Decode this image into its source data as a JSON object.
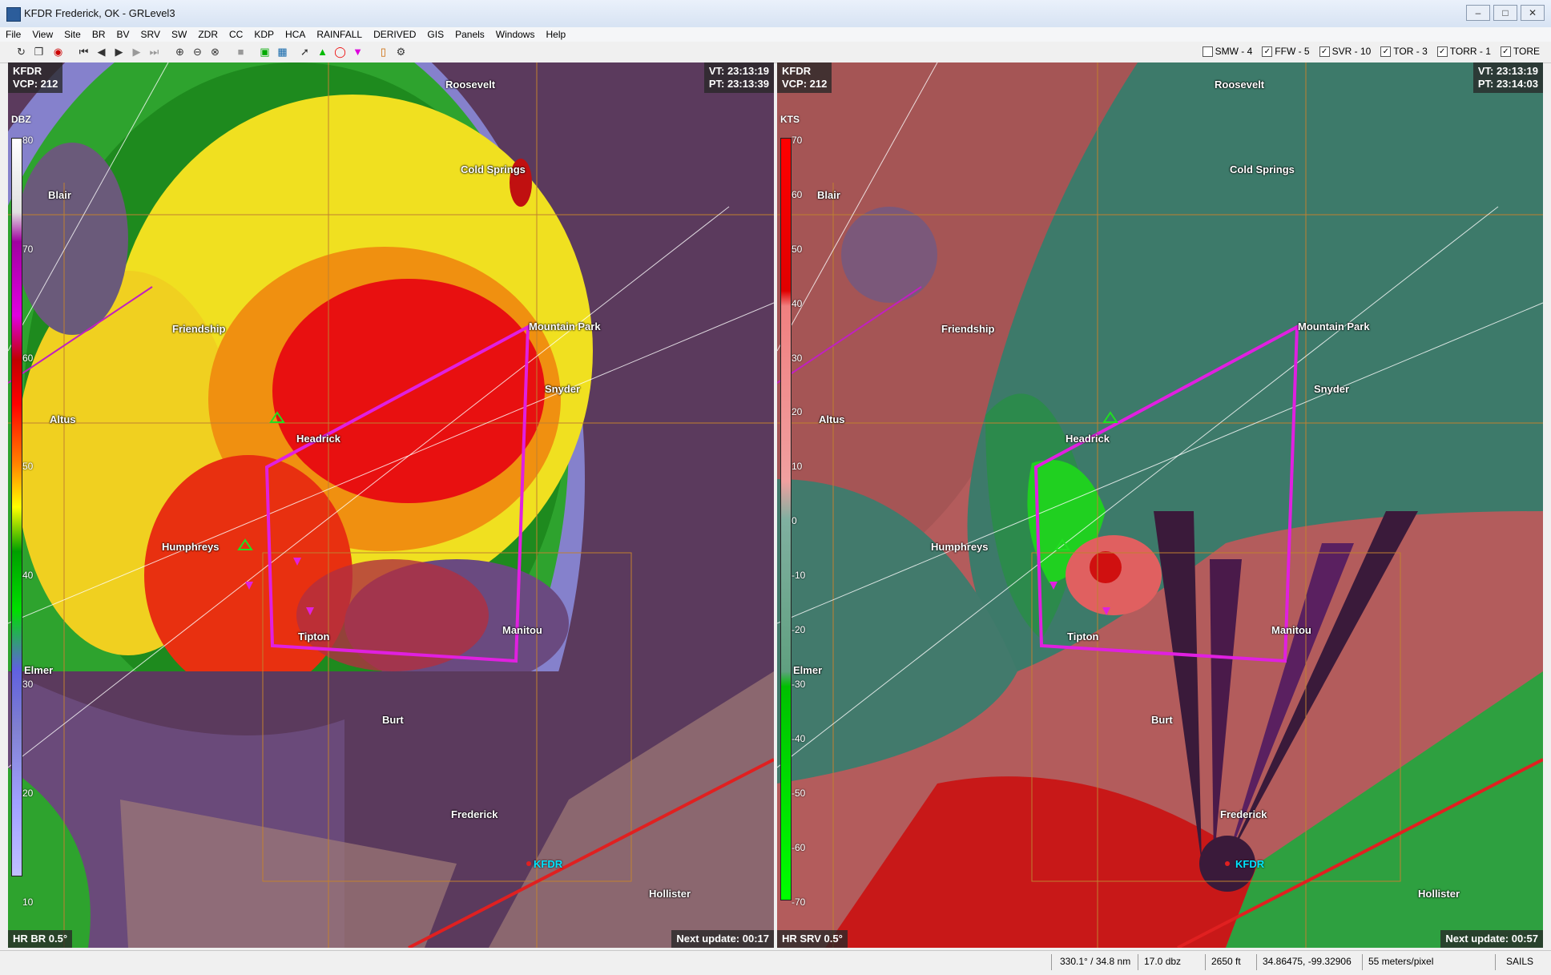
{
  "window": {
    "title": "KFDR Frederick, OK - GRLevel3"
  },
  "menu": [
    "File",
    "View",
    "Site",
    "BR",
    "BV",
    "SRV",
    "SW",
    "ZDR",
    "CC",
    "KDP",
    "HCA",
    "RAINFALL",
    "DERIVED",
    "GIS",
    "Panels",
    "Windows",
    "Help"
  ],
  "warnings": [
    {
      "label": "SMW - 4",
      "checked": false
    },
    {
      "label": "FFW - 5",
      "checked": true
    },
    {
      "label": "SVR - 10",
      "checked": true
    },
    {
      "label": "TOR - 3",
      "checked": true
    },
    {
      "label": "TORR - 1",
      "checked": true
    },
    {
      "label": "TORE",
      "checked": true
    }
  ],
  "left_panel": {
    "site": "KFDR",
    "vcp": "VCP: 212",
    "vt": "VT: 23:13:19",
    "pt": "PT: 23:13:39",
    "legend_unit": "DBZ",
    "legend_ticks": [
      "80",
      "70",
      "60",
      "50",
      "40",
      "30",
      "20",
      "10"
    ],
    "product": "HR BR 0.5°",
    "next_update": "Next update: 00:17"
  },
  "right_panel": {
    "site": "KFDR",
    "vcp": "VCP: 212",
    "vt": "VT: 23:13:19",
    "pt": "PT: 23:14:03",
    "legend_unit": "KTS",
    "legend_ticks": [
      "70",
      "60",
      "50",
      "40",
      "30",
      "20",
      "10",
      "0",
      "-10",
      "-20",
      "-30",
      "-40",
      "-50",
      "-60",
      "-70"
    ],
    "product": "HR SRV 0.5°",
    "next_update": "Next update: 00:57"
  },
  "towns": [
    "Roosevelt",
    "Cold Springs",
    "Blair",
    "Friendship",
    "Mountain Park",
    "Snyder",
    "Altus",
    "Headrick",
    "Humphreys",
    "Tipton",
    "Manitou",
    "Elmer",
    "Burt",
    "Frederick",
    "Hollister"
  ],
  "radar_label": "KFDR",
  "status": {
    "azimuth_range": "330.1° / 34.8 nm",
    "value": "17.0 dbz",
    "height": "2650 ft",
    "latlon": "34.86475, -99.32906",
    "scale": "55 meters/pixel",
    "mode": "SAILS"
  },
  "colors": {
    "warning_polygon": "#e020e0",
    "highway": "#e02020"
  }
}
